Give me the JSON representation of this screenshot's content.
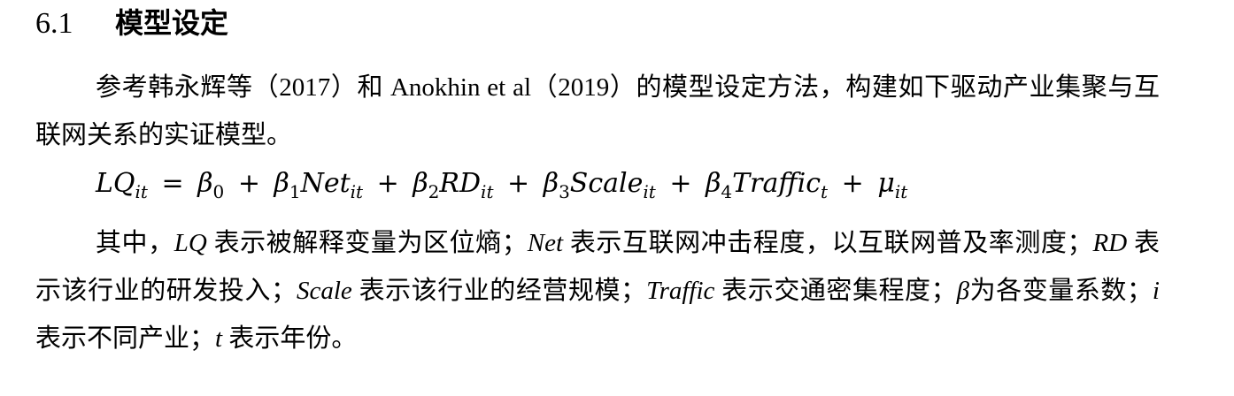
{
  "section": {
    "number": "6.1",
    "title": "模型设定"
  },
  "paragraph1": {
    "text": "参考韩永辉等（2017）和 Anokhin et al（2019）的模型设定方法，构建如下驱动产业集聚与互联网关系的实证模型。"
  },
  "equation": {
    "lhs": "LQ",
    "lhs_sub": "it",
    "eq": "=",
    "plus": "+",
    "b0": "β",
    "b0_sub": "0",
    "b1": "β",
    "b1_sub": "1",
    "net": "Net",
    "net_sub": "it",
    "b2": "β",
    "b2_sub": "2",
    "rd": "RD",
    "rd_sub": "it",
    "b3": "β",
    "b3_sub": "3",
    "scale": "Scale",
    "scale_sub": "it",
    "b4": "β",
    "b4_sub": "4",
    "traffic": "Traffic",
    "traffic_sub": "t",
    "mu": "μ",
    "mu_sub": "it"
  },
  "paragraph2": {
    "s1": "其中，",
    "lq": "LQ",
    "s2": " 表示被解释变量为区位熵；",
    "net": "Net",
    "s3": " 表示互联网冲击程度，以互联网普及率测度；",
    "rd": "RD",
    "s4": " 表示该行业的研发投入；",
    "scale": "Scale",
    "s5": " 表示该行业的经营规模；",
    "traffic": "Traffic",
    "s6": " 表示交通密集程度；",
    "beta": "β",
    "s7": "为各变量系数；",
    "i": "i",
    "s8": " 表示不同产业；",
    "t": "t",
    "s9": " 表示年份。"
  }
}
